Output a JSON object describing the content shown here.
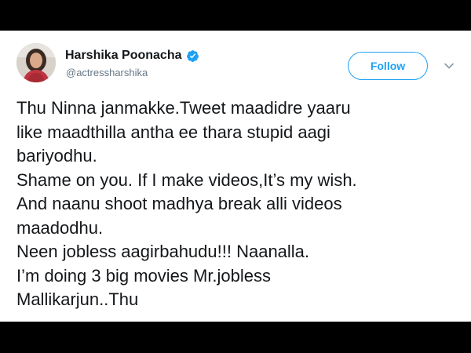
{
  "tweet": {
    "author": {
      "display_name": "Harshika Poonacha",
      "handle": "@actressharshika",
      "verified": true
    },
    "follow_button": {
      "label": "Follow"
    },
    "body_lines": [
      "Thu Ninna janmakke.Tweet maadidre yaaru",
      "like maadthilla antha ee thara stupid aagi",
      "bariyodhu.",
      "Shame on you. If I make videos,It’s my wish.",
      "And naanu shoot madhya break alli videos",
      "maadodhu.",
      "Neen jobless aagirbahudu!!! Naanalla.",
      "I’m doing 3 big movies Mr.jobless",
      "Mallikarjun..Thu"
    ]
  },
  "colors": {
    "background": "#000000",
    "card": "#ffffff",
    "accent": "#1da1f2",
    "text": "#14171a",
    "muted": "#657786"
  },
  "icons": {
    "verified": "verified-badge-icon",
    "caret": "chevron-down-icon",
    "avatar": "profile-photo"
  }
}
